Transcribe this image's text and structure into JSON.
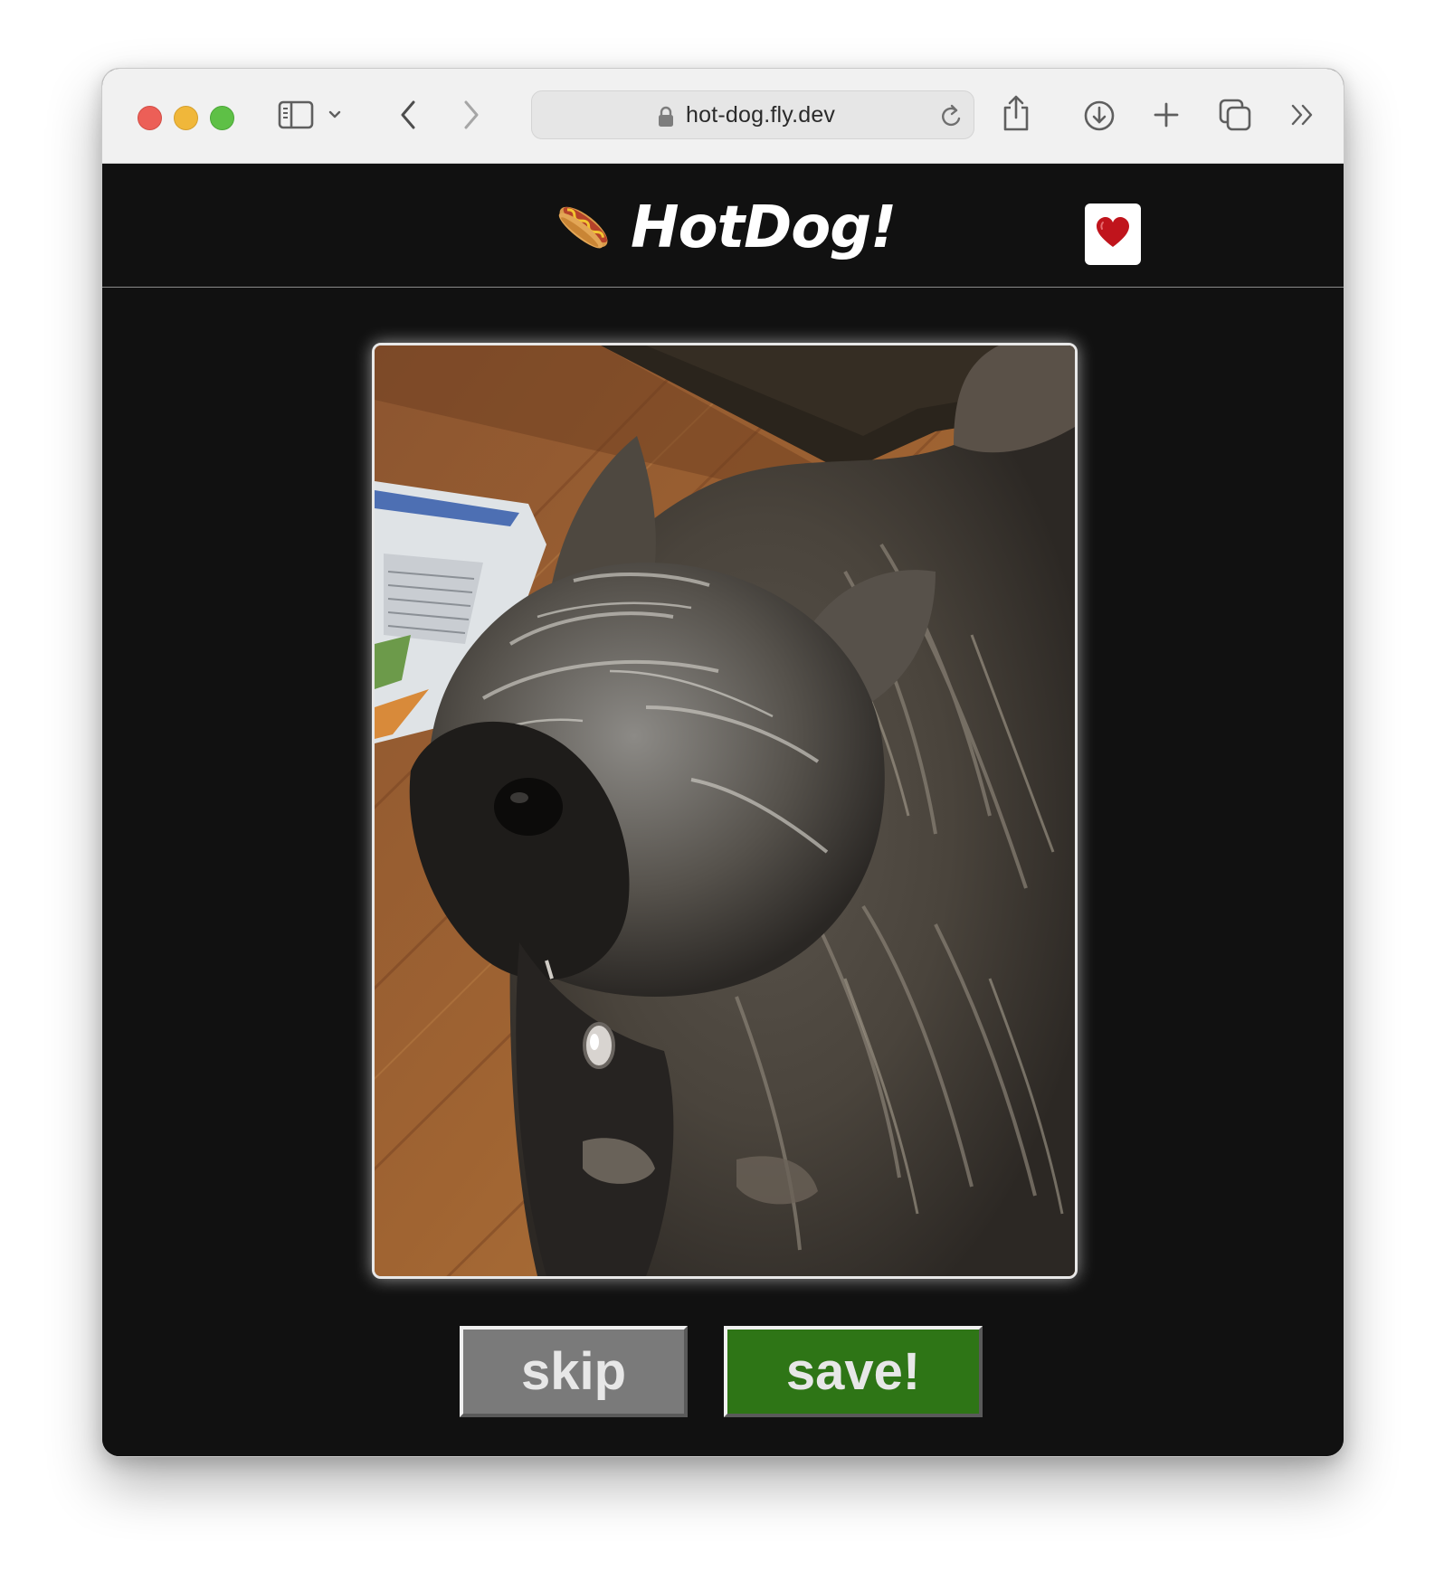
{
  "browser": {
    "url": "hot-dog.fly.dev",
    "icons": {
      "sidebar": "sidebar-icon",
      "chevron": "chevron-down-icon",
      "back": "back-arrow-icon",
      "forward": "forward-arrow-icon",
      "lock": "lock-icon",
      "reload": "reload-icon",
      "share": "share-icon",
      "download": "download-icon",
      "new_tab": "plus-icon",
      "tabs": "tab-overview-icon",
      "more": "chevron-double-right-icon"
    }
  },
  "app": {
    "logo_emoji": "🌭",
    "title": "HotDog!",
    "favorites_icon": "heart-icon",
    "photo_alt": "dog photo",
    "skip_label": "skip",
    "save_label": "save!",
    "colors": {
      "background": "#111111",
      "skip_button": "#7a7a7a",
      "save_button": "#2e7516",
      "heart": "#c0141c"
    }
  }
}
